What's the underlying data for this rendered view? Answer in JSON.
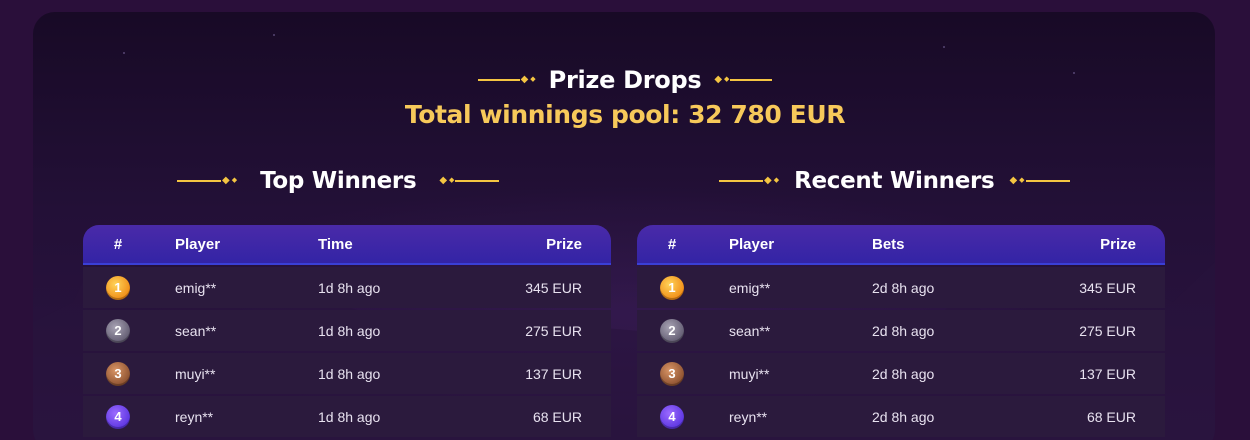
{
  "header": {
    "title": "Prize Drops",
    "pool_text": "Total winnings pool: 32 780 EUR"
  },
  "top_winners": {
    "title": "Top Winners",
    "columns": [
      "#",
      "Player",
      "Time",
      "Prize"
    ],
    "rows": [
      {
        "rank": "1",
        "player": "emig**",
        "time": "1d 8h ago",
        "prize": "345 EUR"
      },
      {
        "rank": "2",
        "player": "sean**",
        "time": "1d 8h ago",
        "prize": "275 EUR"
      },
      {
        "rank": "3",
        "player": "muyi**",
        "time": "1d 8h ago",
        "prize": "137 EUR"
      },
      {
        "rank": "4",
        "player": "reyn**",
        "time": "1d 8h ago",
        "prize": "68 EUR"
      }
    ]
  },
  "recent_winners": {
    "title": "Recent Winners",
    "columns": [
      "#",
      "Player",
      "Bets",
      "Prize"
    ],
    "rows": [
      {
        "rank": "1",
        "player": "emig**",
        "time": "2d 8h ago",
        "prize": "345 EUR"
      },
      {
        "rank": "2",
        "player": "sean**",
        "time": "2d 8h ago",
        "prize": "275 EUR"
      },
      {
        "rank": "3",
        "player": "muyi**",
        "time": "2d 8h ago",
        "prize": "137 EUR"
      },
      {
        "rank": "4",
        "player": "reyn**",
        "time": "2d 8h ago",
        "prize": "68 EUR"
      }
    ]
  },
  "colors": {
    "accent_gold": "#f4c542",
    "pool_text": "#f7c95a",
    "header_bar": "#3a2aa8",
    "row_bg": "#2b1a3d",
    "badge_gold": "#f08a14",
    "badge_silver": "#605a70",
    "badge_bronze": "#8a4f2e",
    "badge_purple": "#5a34e0"
  }
}
